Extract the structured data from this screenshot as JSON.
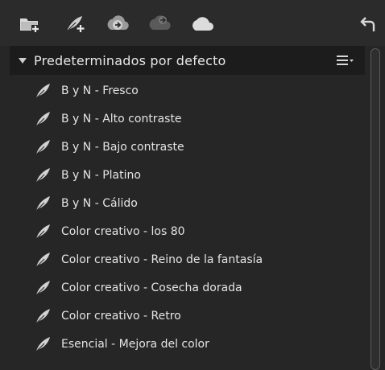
{
  "toolbar": {
    "icons": [
      "add-folder-icon",
      "new-preset-icon",
      "import-icon",
      "export-icon",
      "cloud-icon",
      "undo-icon"
    ]
  },
  "section": {
    "title": "Predeterminados por defecto",
    "expanded": true
  },
  "presets": [
    {
      "label": "B y N - Fresco"
    },
    {
      "label": "B y N - Alto contraste"
    },
    {
      "label": "B y N - Bajo contraste"
    },
    {
      "label": "B y N - Platino"
    },
    {
      "label": "B y N - Cálido"
    },
    {
      "label": "Color creativo - los 80"
    },
    {
      "label": "Color creativo - Reino de la fantasía"
    },
    {
      "label": "Color creativo - Cosecha dorada"
    },
    {
      "label": "Color creativo - Retro"
    },
    {
      "label": "Esencial - Mejora del color"
    }
  ],
  "colors": {
    "background": "#262626",
    "header": "#1c1c1c",
    "text": "#e4e4e4",
    "icon": "#d8d8d8"
  }
}
